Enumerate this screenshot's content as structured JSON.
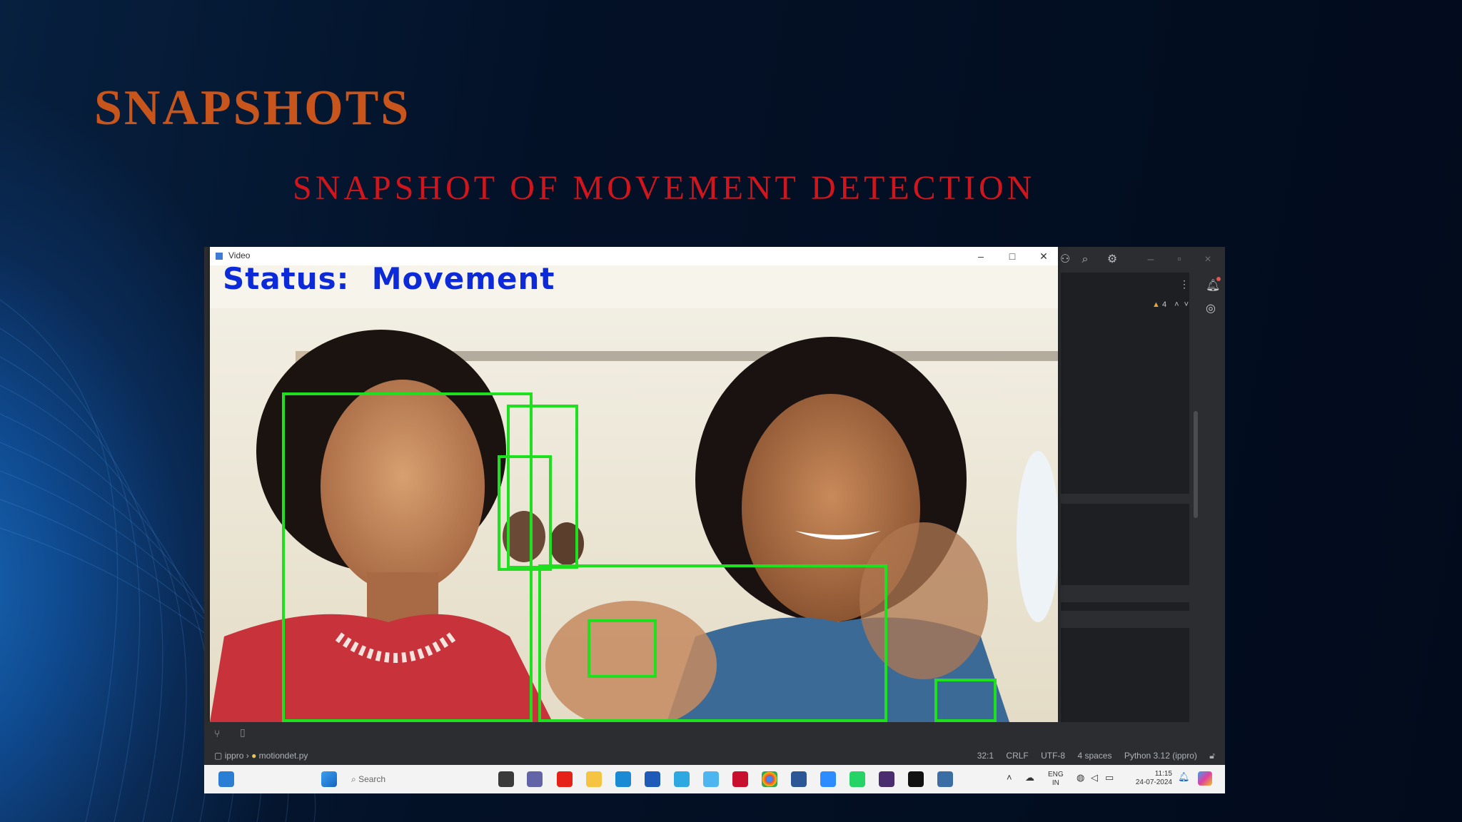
{
  "slide": {
    "title": "SNAPSHOTS",
    "subtitle": "SNAPSHOT OF MOVEMENT DETECTION"
  },
  "video_window": {
    "title": "Video",
    "status_label": "Status:",
    "status_value": "Movement",
    "minimize_icon": "minimize-icon",
    "maximize_icon": "maximize-icon",
    "close_icon": "close-icon"
  },
  "ide": {
    "warnings_count": "4",
    "project": "ippro",
    "file": "motiondet.py",
    "status": {
      "position": "32:1",
      "line_ending": "CRLF",
      "encoding": "UTF-8",
      "indent": "4 spaces",
      "interpreter": "Python 3.12 (ippro)"
    }
  },
  "taskbar": {
    "search_placeholder": "Search",
    "language_top": "ENG",
    "language_bottom": "IN",
    "time": "11:15",
    "date": "24-07-2024"
  },
  "colors": {
    "title": "#c8551c",
    "subtitle": "#d0161c",
    "detection_box": "#1fe01f",
    "status_text": "#0d2ad8"
  }
}
